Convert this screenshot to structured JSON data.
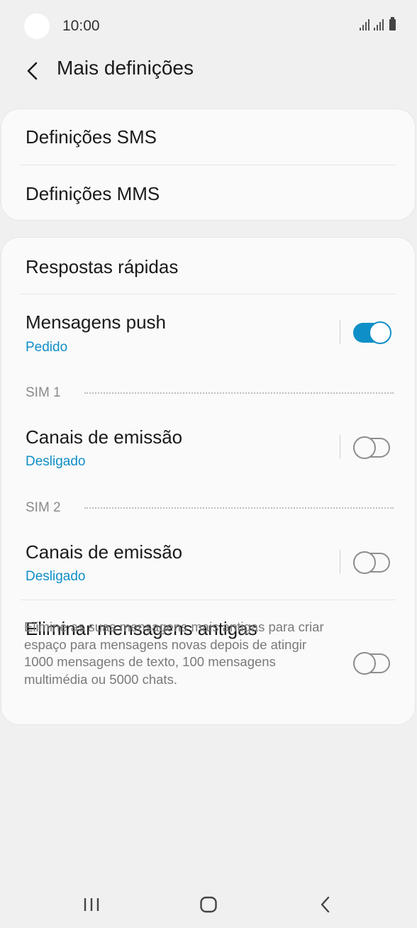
{
  "status_bar": {
    "time": "10:00"
  },
  "header": {
    "title": "Mais definições"
  },
  "group1": {
    "items": [
      {
        "label": "Definições SMS"
      },
      {
        "label": "Definições MMS"
      }
    ]
  },
  "group2": {
    "quick_replies": {
      "label": "Respostas rápidas"
    },
    "push": {
      "title": "Mensagens push",
      "subtitle": "Pedido",
      "enabled": true
    },
    "sim1": {
      "header": "SIM 1",
      "broadcast": {
        "title": "Canais de emissão",
        "subtitle": "Desligado",
        "enabled": false
      }
    },
    "sim2": {
      "header": "SIM 2",
      "broadcast": {
        "title": "Canais de emissão",
        "subtitle": "Desligado",
        "enabled": false
      }
    },
    "delete_old": {
      "title": "Eliminar mensagens antigas",
      "description": "Elimine as suas mensagens mais antigas para criar espaço para mensagens novas depois de atingir 1000 mensagens de texto, 100 mensagens multimédia ou 5000 chats.",
      "enabled": false
    }
  },
  "nav_bar": {
    "items": [
      "recent-apps-icon",
      "home-icon",
      "back-icon"
    ]
  },
  "colors": {
    "accent": "#0f8fc7",
    "background": "#f0f0f0",
    "card": "#fafafa"
  }
}
